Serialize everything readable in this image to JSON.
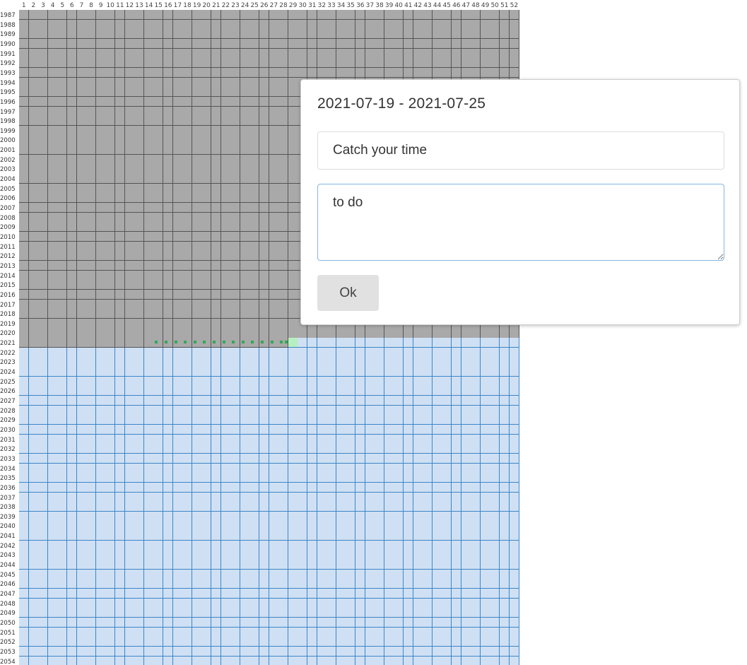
{
  "calendar": {
    "weeks": [
      "1",
      "2",
      "3",
      "4",
      "5",
      "6",
      "7",
      "8",
      "9",
      "10",
      "11",
      "12",
      "13",
      "14",
      "15",
      "16",
      "17",
      "18",
      "19",
      "20",
      "21",
      "22",
      "23",
      "24",
      "25",
      "26",
      "27",
      "28",
      "29",
      "30",
      "31",
      "32",
      "33",
      "34",
      "35",
      "36",
      "37",
      "38",
      "39",
      "40",
      "41",
      "42",
      "43",
      "44",
      "45",
      "46",
      "47",
      "48",
      "49",
      "50",
      "51",
      "52"
    ],
    "years": [
      "1987",
      "1988",
      "1989",
      "1990",
      "1991",
      "1992",
      "1993",
      "1994",
      "1995",
      "1996",
      "1997",
      "1998",
      "1999",
      "2000",
      "2001",
      "2002",
      "2003",
      "2004",
      "2005",
      "2006",
      "2007",
      "2008",
      "2009",
      "2010",
      "2011",
      "2012",
      "2013",
      "2014",
      "2015",
      "2016",
      "2017",
      "2018",
      "2019",
      "2020",
      "2021",
      "2022",
      "2023",
      "2024",
      "2025",
      "2026",
      "2027",
      "2028",
      "2029",
      "2030",
      "2031",
      "2032",
      "2033",
      "2034",
      "2035",
      "2036",
      "2037",
      "2038",
      "2039",
      "2040",
      "2041",
      "2042",
      "2043",
      "2044",
      "2045",
      "2046",
      "2047",
      "2048",
      "2049",
      "2050",
      "2051",
      "2052",
      "2053",
      "2054"
    ],
    "current_year": "2021",
    "current_week": "29",
    "marked_weeks_start": "15",
    "marked_weeks_end": "28",
    "colors": {
      "past": "#a9a9a9",
      "future": "#cfe0f4",
      "current": "#b7f0c0",
      "marked": "#2eaa55",
      "future_border": "#3d85c6"
    }
  },
  "dialog": {
    "title": "2021-07-19 - 2021-07-25",
    "title_input_value": "Catch your time",
    "note_value": "to do",
    "ok_label": "Ok"
  }
}
